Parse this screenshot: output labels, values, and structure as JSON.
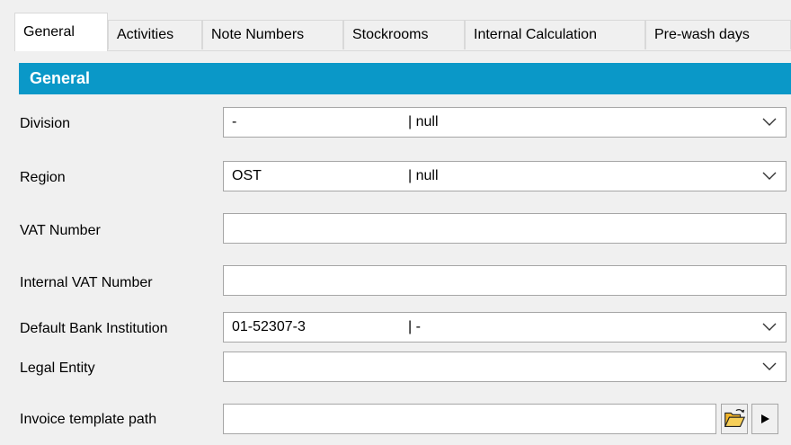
{
  "tabs": [
    {
      "label": "General"
    },
    {
      "label": "Activities"
    },
    {
      "label": "Note Numbers"
    },
    {
      "label": "Stockrooms"
    },
    {
      "label": "Internal Calculation"
    },
    {
      "label": "Pre-wash days"
    }
  ],
  "section": {
    "title": "General"
  },
  "fields": {
    "division": {
      "label": "Division",
      "value": "-",
      "secondary": "| null"
    },
    "region": {
      "label": "Region",
      "value": "OST",
      "secondary": "| null"
    },
    "vat_number": {
      "label": "VAT Number",
      "value": ""
    },
    "internal_vat_number": {
      "label": "Internal VAT Number",
      "value": ""
    },
    "default_bank_institution": {
      "label": "Default Bank Institution",
      "value": "01-52307-3",
      "secondary": "| -"
    },
    "legal_entity": {
      "label": "Legal Entity",
      "value": ""
    },
    "invoice_template_path": {
      "label": "Invoice template path",
      "value": ""
    }
  },
  "icons": {
    "browse": "open-folder-icon",
    "run": "play-icon",
    "dropdown": "chevron-down-icon"
  },
  "colors": {
    "header_bg": "#0a98c8",
    "header_text": "#ffffff",
    "background": "#f0f0f0"
  }
}
